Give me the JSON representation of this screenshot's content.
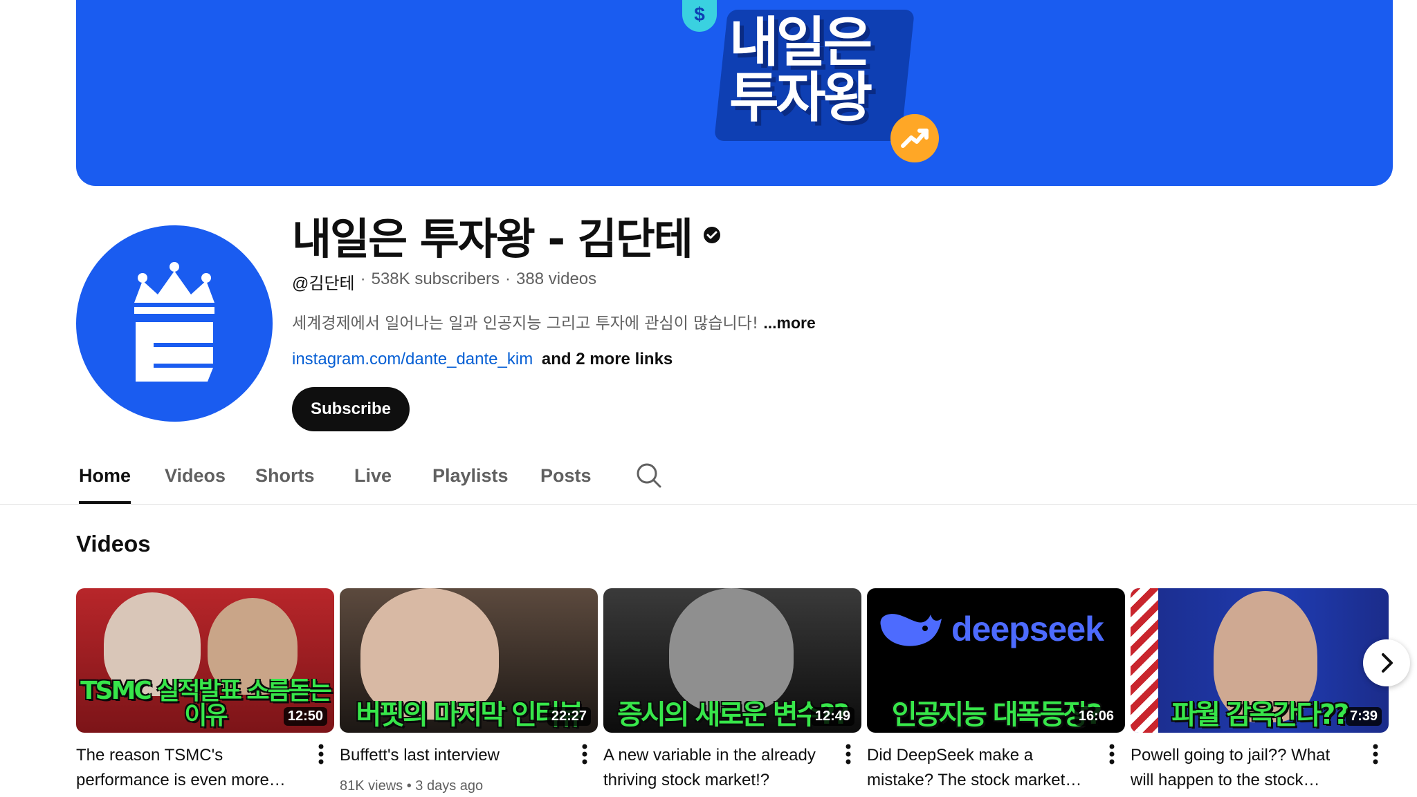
{
  "banner": {
    "line1": "내일은",
    "line2": "투자왕",
    "coin_symbol": "$",
    "bg_color": "#1a5cf0",
    "coin_icon": "dollar-coin-icon",
    "trend_icon": "trending-up-icon"
  },
  "channel": {
    "name": "내일은 투자왕 - 김단테",
    "handle": "@김단테",
    "subscribers": "538K subscribers",
    "videos_count": "388 videos",
    "separator": "·",
    "description": "세계경제에서 일어나는 일과 인공지능 그리고 투자에 관심이 많습니다!",
    "more_label": "...more",
    "link": "instagram.com/dante_dante_kim",
    "more_links": "and 2 more links",
    "subscribe_label": "Subscribe"
  },
  "tabs": [
    {
      "label": "Home",
      "active": true
    },
    {
      "label": "Videos"
    },
    {
      "label": "Shorts"
    },
    {
      "label": "Live"
    },
    {
      "label": "Playlists"
    },
    {
      "label": "Posts"
    }
  ],
  "section": {
    "title": "Videos"
  },
  "videos": [
    {
      "thumb_text": "TSMC 실적발표 소름돋는 이유",
      "duration": "12:50",
      "title": "The reason TSMC's performance is even more…"
    },
    {
      "thumb_text": "버핏의 마지막 인터뷰",
      "duration": "22:27",
      "title": "Buffett's last interview",
      "views": "81K views",
      "age": "3 days ago"
    },
    {
      "thumb_text": "증시의 새로운 변수??",
      "duration": "12:49",
      "title": "A new variable in the already thriving stock market!?"
    },
    {
      "thumb_text": "인공지능 대폭등장?",
      "brand": "deepseek",
      "duration": "16:06",
      "title": "Did DeepSeek make a mistake? The stock market…"
    },
    {
      "thumb_text": "파월 감옥간다??",
      "duration": "7:39",
      "title": "Powell going to jail?? What will happen to the stock…"
    }
  ]
}
